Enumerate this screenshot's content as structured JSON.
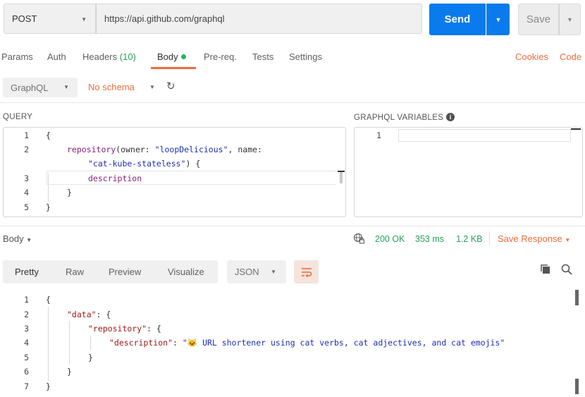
{
  "request": {
    "method": "POST",
    "url": "https://api.github.com/graphql",
    "send_label": "Send",
    "save_label": "Save"
  },
  "tabs": [
    {
      "label": "Params"
    },
    {
      "label": "Auth"
    },
    {
      "label": "Headers",
      "count": "(10)"
    },
    {
      "label": "Body",
      "active": true
    },
    {
      "label": "Pre-req."
    },
    {
      "label": "Tests"
    },
    {
      "label": "Settings"
    }
  ],
  "links": {
    "cookies": "Cookies",
    "code": "Code"
  },
  "body_mode": {
    "type": "GraphQL",
    "schema": "No schema"
  },
  "query": {
    "label": "QUERY",
    "line_numbers": [
      "1",
      "2",
      "3",
      "4",
      "5"
    ],
    "lines": {
      "l1": "{",
      "l2_field": "repository",
      "l2_open": "(owner: ",
      "l2_owner": "\"loopDelicious\"",
      "l2_sep": ", name:",
      "l2b_name": "\"cat-kube-stateless\"",
      "l2b_close": ") {",
      "l3_field": "description",
      "l4": "}",
      "l5": "}"
    }
  },
  "variables": {
    "label": "GRAPHQL VARIABLES",
    "line_numbers": [
      "1"
    ]
  },
  "response": {
    "label": "Body",
    "status": "200 OK",
    "time": "353 ms",
    "size": "1.2 KB",
    "save_label": "Save Response",
    "tabs": [
      {
        "label": "Pretty",
        "active": true
      },
      {
        "label": "Raw"
      },
      {
        "label": "Preview"
      },
      {
        "label": "Visualize"
      }
    ],
    "format": "JSON",
    "line_numbers": [
      "1",
      "2",
      "3",
      "4",
      "5",
      "6",
      "7"
    ],
    "json": {
      "l1": "{",
      "l2_key": "\"data\"",
      "l2_rest": ": {",
      "l3_key": "\"repository\"",
      "l3_rest": ": {",
      "l4_key": "\"description\"",
      "l4_colon": ": ",
      "l4_value_open": "\"",
      "l4_emoji": "🐱",
      "l4_value": " URL shortener using cat verbs, cat adjectives, and cat emojis\"",
      "l5": "}",
      "l6": "}",
      "l7": "}"
    }
  },
  "colors": {
    "accent": "#f26b3a",
    "primary": "#097bed",
    "success": "#26a35a"
  }
}
